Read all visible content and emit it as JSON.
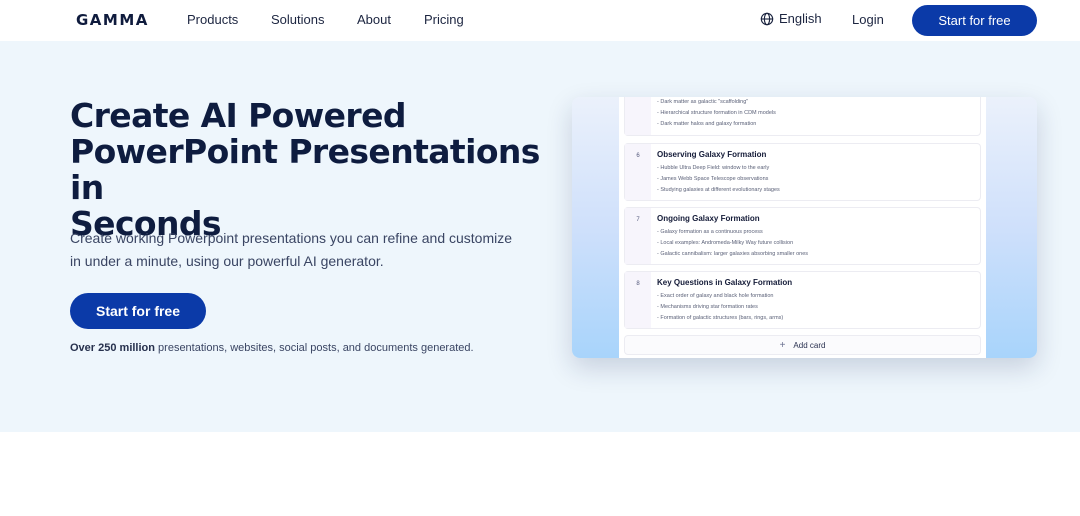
{
  "nav": {
    "logo": "GAMMA",
    "links": [
      "Products",
      "Solutions",
      "About",
      "Pricing"
    ],
    "language": "English",
    "login": "Login",
    "cta": "Start for free"
  },
  "hero": {
    "headline_line1": "Create AI Powered",
    "headline_line2": "PowerPoint Presentations in",
    "headline_line3": "Seconds",
    "subtext_line1": "Create working Powerpoint presentations you can refine and customize",
    "subtext_line2": "in under a minute, using our powerful AI generator.",
    "cta": "Start for free",
    "stat_bold": "Over 250 million",
    "stat_rest": " presentations, websites, social posts, and documents generated."
  },
  "preview": {
    "partial_card": {
      "bullets": [
        "- Dark matter as galactic \"scaffolding\"",
        "- Hierarchical structure formation in CDM models",
        "- Dark matter halos and galaxy formation"
      ]
    },
    "cards": [
      {
        "number": "6",
        "title": "Observing Galaxy Formation",
        "bullets": [
          "- Hubble Ultra Deep Field: window to the early",
          "- James Webb Space Telescope observations",
          "- Studying galaxies at different evolutionary stages"
        ]
      },
      {
        "number": "7",
        "title": "Ongoing Galaxy Formation",
        "bullets": [
          "- Galaxy formation as a continuous process",
          "- Local examples: Andromeda-Milky Way future collision",
          "- Galactic cannibalism: larger galaxies absorbing smaller ones"
        ]
      },
      {
        "number": "8",
        "title": "Key Questions in Galaxy Formation",
        "bullets": [
          "- Exact order of galaxy and black hole formation",
          "- Mechanisms driving star formation rates",
          "- Formation of galactic structures (bars, rings, arms)"
        ]
      }
    ],
    "add_card": "Add card"
  },
  "colors": {
    "brand_blue": "#0b3aa8",
    "hero_bg": "#eef6fc",
    "heading": "#0e1c3f"
  }
}
